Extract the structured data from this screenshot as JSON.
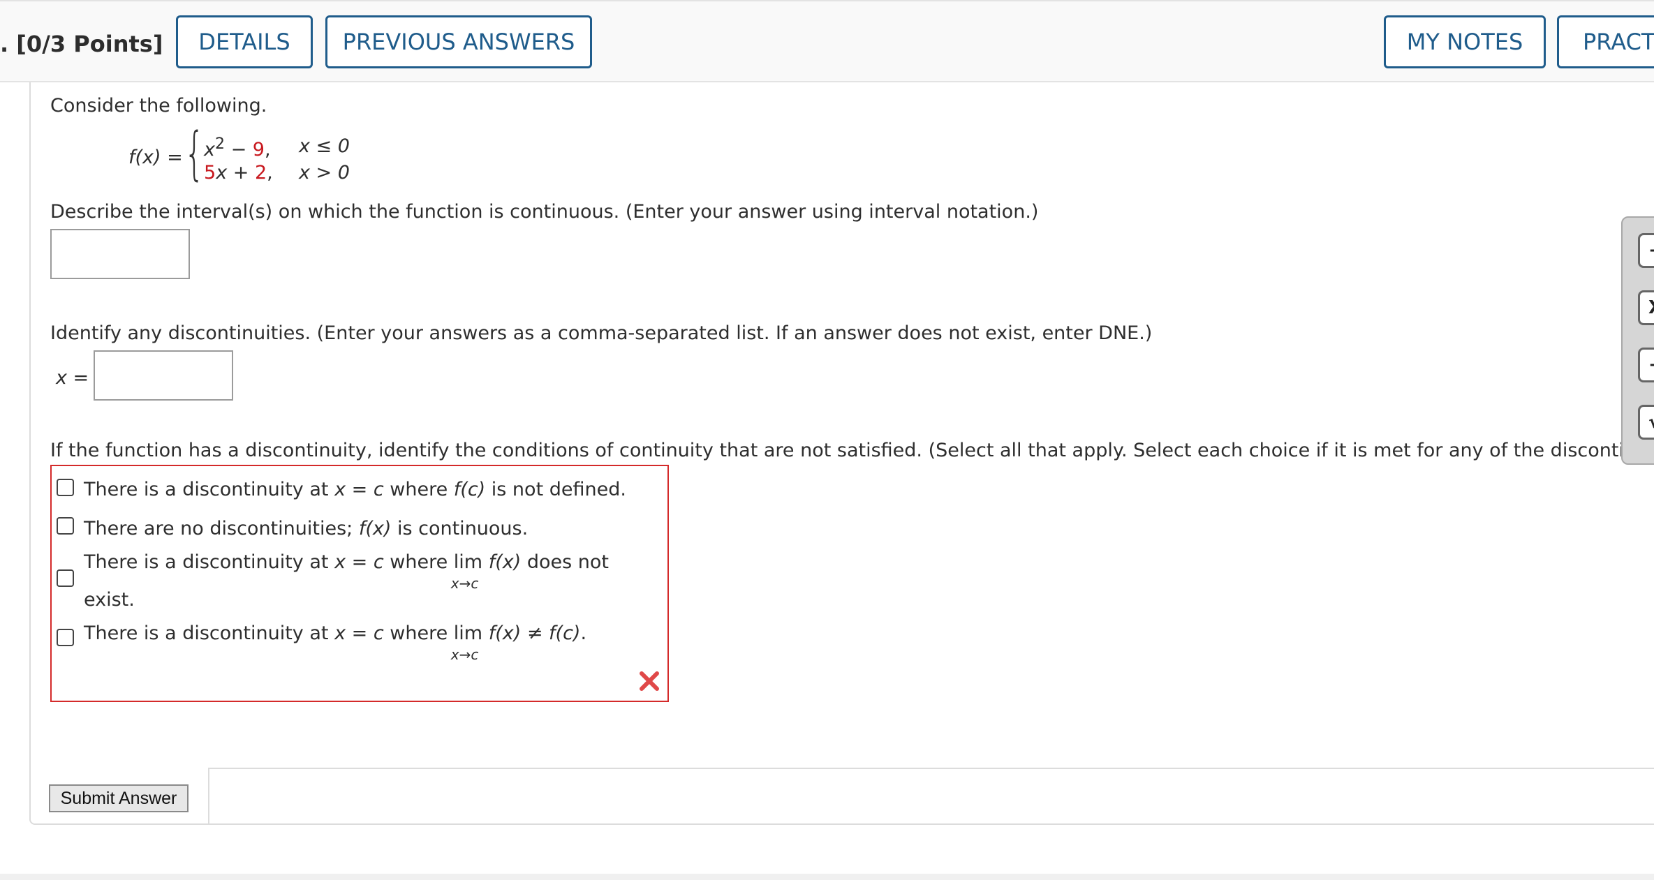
{
  "header": {
    "points_label": ". [0/3 Points]",
    "details_label": "DETAILS",
    "previous_answers_label": "PREVIOUS ANSWERS",
    "my_notes_label": "MY NOTES",
    "practice_label": "PRACT"
  },
  "question": {
    "intro": "Consider the following.",
    "function": {
      "lhs": "f(x) =",
      "case1_expr_a": "x",
      "case1_sup": "2",
      "case1_minus": " − ",
      "case1_const": "9",
      "case1_comma": ",",
      "case1_cond": "x ≤ 0",
      "case2_coef": "5",
      "case2_var": "x",
      "case2_plus": " + ",
      "case2_const": "2",
      "case2_comma": ",",
      "case2_cond": "x > 0"
    },
    "part1_prompt": "Describe the interval(s) on which the function is continuous. (Enter your answer using interval notation.)",
    "part1_value": "",
    "part2_prompt": "Identify any discontinuities. (Enter your answers as a comma-separated list. If an answer does not exist, enter DNE.)",
    "part2_label": "x =",
    "part2_value": "",
    "part3_prompt": "If the function has a discontinuity, identify the conditions of continuity that are not satisfied. (Select all that apply. Select each choice if it is met for any of the discontinuitie",
    "options": {
      "opt1_a": "There is a discontinuity at ",
      "opt1_b": "x = c",
      "opt1_c": " where ",
      "opt1_d": "f(c)",
      "opt1_e": " is not defined.",
      "opt2_a": "There are no discontinuities; ",
      "opt2_b": "f(x)",
      "opt2_c": " is continuous.",
      "opt3_a": "There is a discontinuity at ",
      "opt3_b": "x = c",
      "opt3_c": " where ",
      "opt3_lim": "lim",
      "opt3_sub": "x→c",
      "opt3_d": "f(x)",
      "opt3_e": " does not",
      "opt3_f": "exist.",
      "opt4_a": "There is a discontinuity at ",
      "opt4_b": "x = c",
      "opt4_c": " where ",
      "opt4_lim": "lim",
      "opt4_sub": "x→c",
      "opt4_d": "f(x) ≠ f(c)",
      "opt4_e": "."
    }
  },
  "submit_label": "Submit Answer",
  "toolbar": {
    "btn1": "−",
    "btn2": "X",
    "btn3": "÷",
    "btn4": "√"
  },
  "colors": {
    "accent": "#1f5c8b",
    "error": "#d42a2a",
    "highlight_red": "#c8181e"
  },
  "icons": [
    "x-mark-icon",
    "checkbox-icon"
  ]
}
